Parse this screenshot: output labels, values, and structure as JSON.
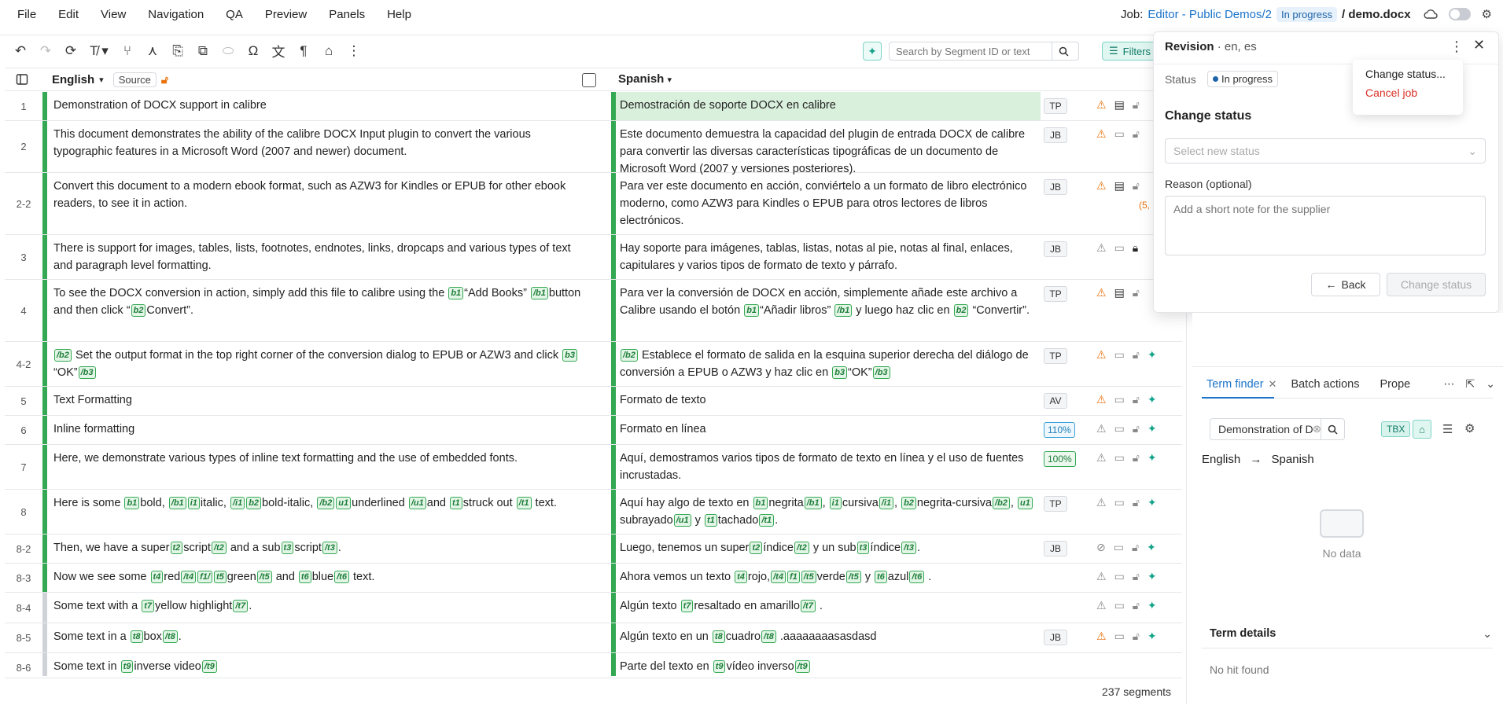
{
  "menubar": {
    "items": [
      "File",
      "Edit",
      "View",
      "Navigation",
      "QA",
      "Preview",
      "Panels",
      "Help"
    ],
    "job_label": "Job:",
    "job_link": "Editor - Public Demos/2",
    "job_status": "In progress",
    "job_file": "/ demo.docx"
  },
  "toolbar": {
    "search_placeholder": "Search by Segment ID or text",
    "filters_label": "Filters"
  },
  "grid": {
    "source_lang": "English",
    "source_tag": "Source",
    "target_lang": "Spanish",
    "footer_count": "237 segments"
  },
  "rows": [
    {
      "num": "1",
      "who": "TP"
    },
    {
      "num": "2",
      "who": "JB"
    },
    {
      "num": "2-2",
      "who": "JB",
      "extra": "(5,"
    },
    {
      "num": "3",
      "who": "JB"
    },
    {
      "num": "4",
      "who": "TP"
    },
    {
      "num": "4-2",
      "who": "TP"
    },
    {
      "num": "5",
      "who": "AV"
    },
    {
      "num": "6",
      "who": "110%"
    },
    {
      "num": "7",
      "who": "100%"
    },
    {
      "num": "8",
      "who": "TP"
    },
    {
      "num": "8-2",
      "who": "JB"
    },
    {
      "num": "8-3",
      "who": ""
    },
    {
      "num": "8-4",
      "who": ""
    },
    {
      "num": "8-5",
      "who": "JB"
    },
    {
      "num": "8-6",
      "who": ""
    }
  ],
  "segments": {
    "s1_src": "Demonstration of DOCX support in calibre",
    "s1_tgt": "Demostración de soporte DOCX en calibre",
    "s2_src": "This document demonstrates the ability of the calibre DOCX Input plugin to convert the various typographic features in a Microsoft Word (2007 and newer) document.",
    "s2_tgt": "Este documento demuestra la capacidad del plugin de entrada DOCX de calibre para convertir las diversas características tipográficas de un documento de Microsoft Word (2007 y versiones posteriores).",
    "s3_src": "Convert this document to a modern ebook format, such as AZW3 for Kindles or EPUB for other ebook readers, to see it in action.",
    "s3_tgt": "Para ver este documento en acción, conviértelo a un formato de libro electrónico moderno, como AZW3 para Kindles o EPUB para otros lectores de libros electrónicos.",
    "s4_src": "There is support for images, tables, lists, footnotes, endnotes, links, dropcaps and various types of text and paragraph level formatting.",
    "s4_tgt": "Hay soporte para imágenes, tablas, listas, notas al pie, notas al final, enlaces, capitulares y varios tipos de formato de texto y párrafo.",
    "s5_src_a": "To see the DOCX conversion in action, simply add this file to calibre using the",
    "s5_src_b": "“Add Books”",
    "s5_src_c": "button and then click “",
    "s5_src_d": "Convert”.",
    "s5_tgt_a": "Para ver la conversión de DOCX en acción, simplemente añade este archivo a Calibre usando el botón",
    "s5_tgt_b": "“Añadir libros”",
    "s5_tgt_c": "y luego haz clic en",
    "s5_tgt_d": "“Convertir”.",
    "s6_src_a": "Set the output format in the top right corner of the conversion dialog to EPUB or AZW3 and click",
    "s6_src_b": "“OK”",
    "s6_tgt_a": "Establece el formato de salida en la esquina superior derecha del diálogo de conversión a EPUB o AZW3 y haz clic en",
    "s6_tgt_b": "“OK”",
    "s7_src": "Text Formatting",
    "s7_tgt": "Formato de texto",
    "s8_src": "Inline formatting",
    "s8_tgt": "Formato en línea",
    "s9_src": "Here, we demonstrate various types of inline text formatting and the use of embedded fonts.",
    "s9_tgt": "Aquí, demostramos varios tipos de formato de texto en línea y el uso de fuentes incrustadas.",
    "s10_src_a": "Here is some",
    "s10_src_b": "bold,",
    "s10_src_c": "italic,",
    "s10_src_d": "bold-italic,",
    "s10_src_e": "underlined",
    "s10_src_f": "and",
    "s10_src_g": "struck out",
    "s10_src_h": "text.",
    "s10_tgt_a": "Aquí hay algo de texto en",
    "s10_tgt_b": "negrita",
    "s10_tgt_c": "cursiva",
    "s10_tgt_d": "negrita-cursiva",
    "s10_tgt_e": "subrayado",
    "s10_tgt_f": "y",
    "s10_tgt_g": "tachado",
    "s11_src_a": "Then, we have a super",
    "s11_src_b": "script",
    "s11_src_c": "and a sub",
    "s11_src_d": "script",
    "s11_tgt_a": "Luego, tenemos un super",
    "s11_tgt_b": "índice",
    "s11_tgt_c": "y un sub",
    "s11_tgt_d": "índice",
    "s12_src_a": "Now we see some",
    "s12_src_b": "red",
    "s12_src_c": "green",
    "s12_src_d": "and",
    "s12_src_e": "blue",
    "s12_src_f": "text.",
    "s12_tgt_a": "Ahora vemos un texto",
    "s12_tgt_b": "rojo,",
    "s12_tgt_c": "verde",
    "s12_tgt_d": "y",
    "s12_tgt_e": "azul",
    "s13_src_a": "Some text with a",
    "s13_src_b": "yellow highlight",
    "s13_tgt_a": "Algún texto",
    "s13_tgt_b": "resaltado en amarillo",
    "s14_src_a": "Some text in a",
    "s14_src_b": "box",
    "s14_tgt_a": "Algún texto en un",
    "s14_tgt_b": "cuadro",
    "s14_tgt_c": ".aaaaaaaasasdasd",
    "s15_src": "Some text in",
    "s15_src_b": "inverse video",
    "s15_tgt": "Parte del texto en",
    "s15_tgt_b": "vídeo inverso"
  },
  "tags": {
    "b1": "b1",
    "b1c": "/b1",
    "b2": "b2",
    "b2c": "/b2",
    "b3": "b3",
    "b3c": "/b3",
    "i1": "i1",
    "i1c": "/i1",
    "u1": "u1",
    "u1c": "/u1",
    "t1": "t1",
    "t1c": "/t1",
    "t2": "t2",
    "t2c": "/t2",
    "t3": "t3",
    "t3c": "/t3",
    "t4": "t4",
    "t4c": "/t4",
    "f1": "f1",
    "f1c": "f1/",
    "t5": "t5",
    "t5c": "/t5",
    "t6": "t6",
    "t6c": "/t6",
    "t7": "t7",
    "t7c": "/t7",
    "t8": "t8",
    "t8c": "/t8",
    "t9": "t9",
    "t9c": "/t9"
  },
  "revision": {
    "title": "Revision",
    "langs": "· en, es",
    "status_label": "Status",
    "status_value": "In progress",
    "change_title": "Change status",
    "select_placeholder": "Select new status",
    "reason_label": "Reason (optional)",
    "reason_placeholder": "Add a short note for the supplier",
    "back_label": "Back",
    "change_label": "Change status"
  },
  "dropdown": {
    "change_status": "Change status...",
    "cancel_job": "Cancel job"
  },
  "term_panel": {
    "tab_term_finder": "Term finder",
    "tab_batch": "Batch actions",
    "tab_props": "Prope",
    "search_value": "Demonstration of D",
    "tbx_label": "TBX",
    "source_lang": "English",
    "target_lang": "Spanish",
    "no_data": "No data",
    "details_title": "Term details",
    "no_hit": "No hit found"
  },
  "colors": {
    "accent_green": "#34a853",
    "active_row_bg": "#d9f0dc",
    "link_blue": "#1a73c9",
    "warn_orange": "#e8710a",
    "ai_teal": "#14a38b"
  }
}
